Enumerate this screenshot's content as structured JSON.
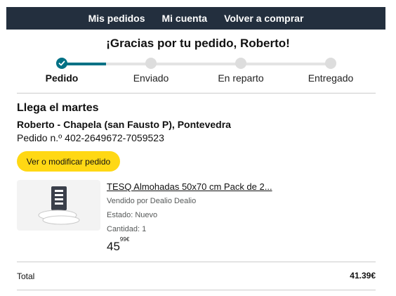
{
  "nav": {
    "items": [
      "Mis pedidos",
      "Mi cuenta",
      "Volver a comprar"
    ]
  },
  "greeting": "¡Gracias por tu pedido, Roberto!",
  "progress": {
    "steps": [
      "Pedido",
      "Enviado",
      "En reparto",
      "Entregado"
    ],
    "current_step": 1
  },
  "delivery": {
    "arrives": "Llega el martes",
    "address": "Roberto - Chapela (san Fausto P), Pontevedra",
    "order_number": "Pedido n.º 402-2649672-7059523"
  },
  "modify_button": "Ver o modificar pedido",
  "product": {
    "title": "TESQ Almohadas 50x70 cm Pack de 2...",
    "seller": "Vendido por Dealio Dealio",
    "condition": "Estado: Nuevo",
    "quantity": "Cantidad: 1",
    "price_whole": "45",
    "price_fraction": "99€"
  },
  "total": {
    "label": "Total",
    "value": "41.39€"
  },
  "colors": {
    "nav_bg": "#232f3e",
    "progress_accent": "#007185",
    "button_yellow": "#ffd814"
  }
}
